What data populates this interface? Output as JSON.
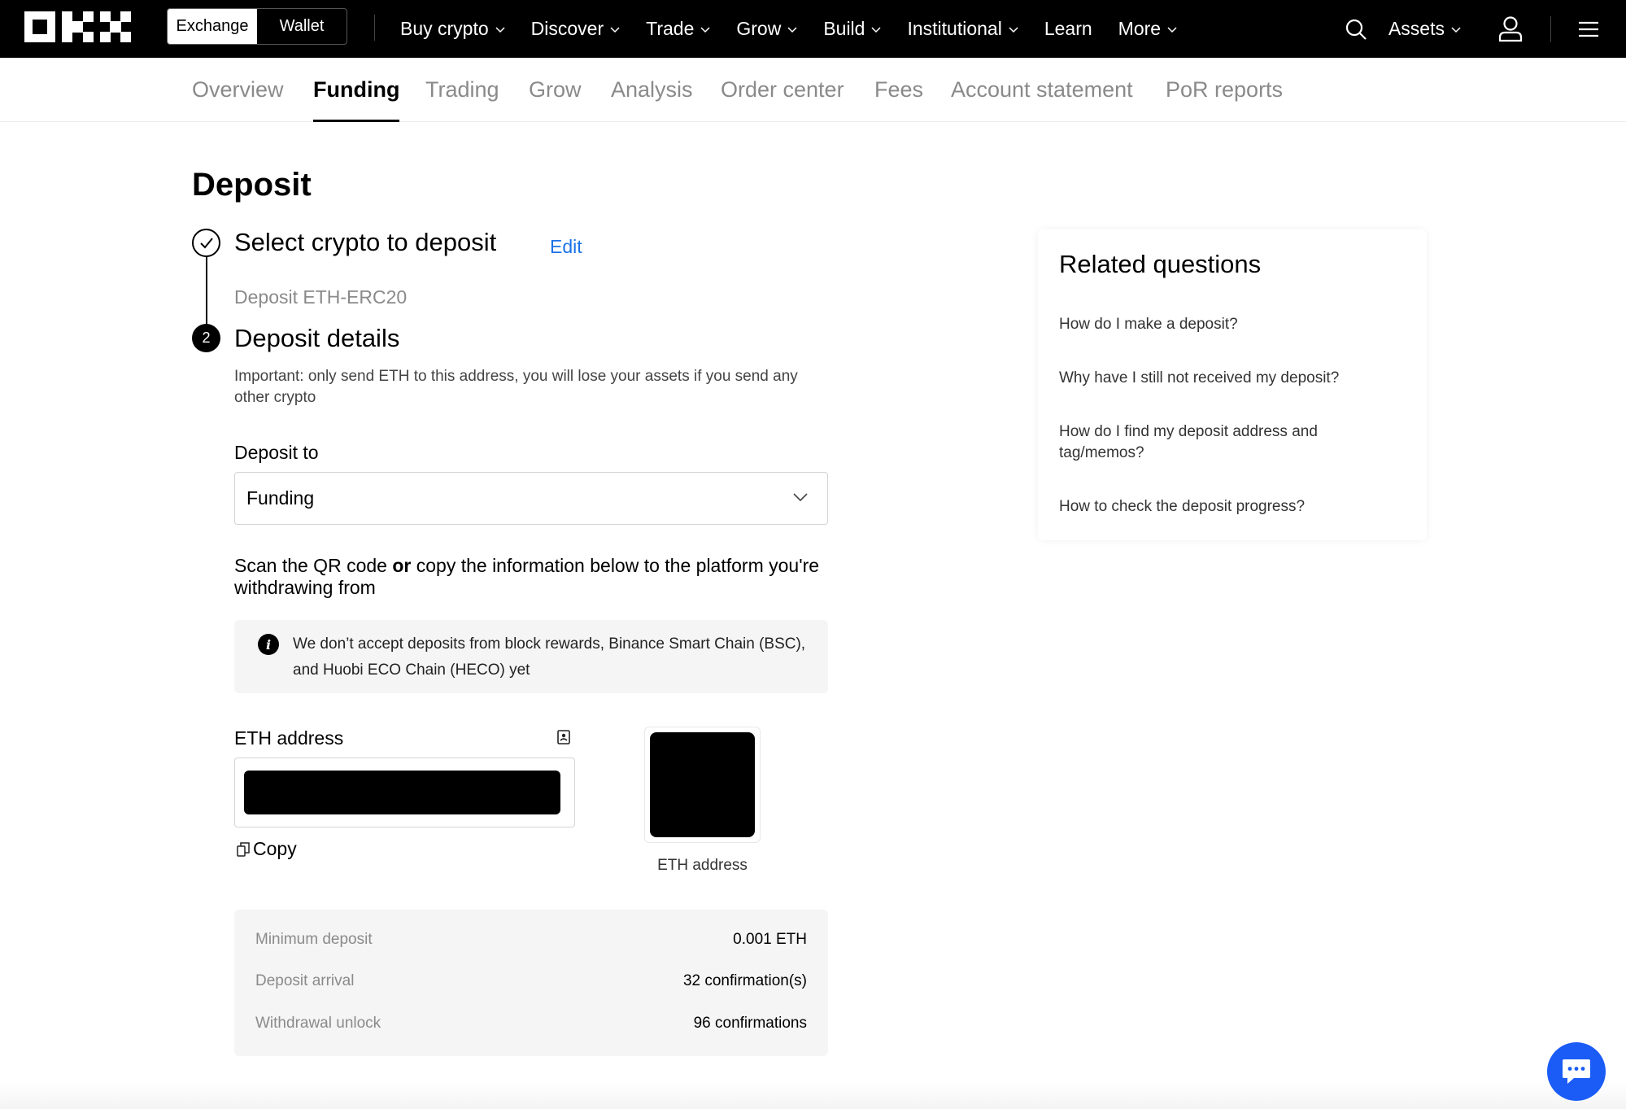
{
  "topnav": {
    "toggle": [
      "Exchange",
      "Wallet"
    ],
    "menu": [
      {
        "label": "Buy crypto",
        "has_dropdown": true
      },
      {
        "label": "Discover",
        "has_dropdown": true
      },
      {
        "label": "Trade",
        "has_dropdown": true
      },
      {
        "label": "Grow",
        "has_dropdown": true
      },
      {
        "label": "Build",
        "has_dropdown": true
      },
      {
        "label": "Institutional",
        "has_dropdown": true
      },
      {
        "label": "Learn",
        "has_dropdown": false
      },
      {
        "label": "More",
        "has_dropdown": true
      }
    ],
    "assets_label": "Assets",
    "icons": [
      "search-icon",
      "user-icon",
      "menu-icon"
    ]
  },
  "subtabs": [
    "Overview",
    "Funding",
    "Trading",
    "Grow",
    "Analysis",
    "Order center",
    "Fees",
    "Account statement",
    "PoR reports"
  ],
  "active_subtab": "Funding",
  "page": {
    "title": "Deposit",
    "step1": {
      "title": "Select crypto to deposit",
      "edit": "Edit",
      "selected": "Deposit ETH-ERC20"
    },
    "step2": {
      "number": "2",
      "title": "Deposit details",
      "important": "Important: only send ETH to this address, you will lose your assets if you send any other crypto",
      "deposit_to_label": "Deposit to",
      "deposit_to_value": "Funding",
      "scan_pre": "Scan the QR code ",
      "scan_bold": "or",
      "scan_post": " copy the information below to the platform you're withdrawing from",
      "notice": "We don’t accept deposits from block rewards, Binance Smart Chain (BSC), and Huobi ECO Chain (HECO) yet",
      "address_label": "ETH address",
      "copy_label": "Copy",
      "qr_caption": "ETH address"
    },
    "info_rows": [
      {
        "label": "Minimum deposit",
        "value": "0.001 ETH"
      },
      {
        "label": "Deposit arrival",
        "value": "32 confirmation(s)"
      },
      {
        "label": "Withdrawal unlock",
        "value": "96 confirmations"
      }
    ]
  },
  "related": {
    "title": "Related questions",
    "questions": [
      "How do I make a deposit?",
      "Why have I still not received my deposit?",
      "How do I find my deposit address and tag/memos?",
      "How to check the deposit progress?"
    ]
  },
  "colors": {
    "nav_bg": "#000000",
    "link": "#1a73e8",
    "chat_button": "#1a5cf5",
    "panel_bg": "#f5f5f5"
  }
}
